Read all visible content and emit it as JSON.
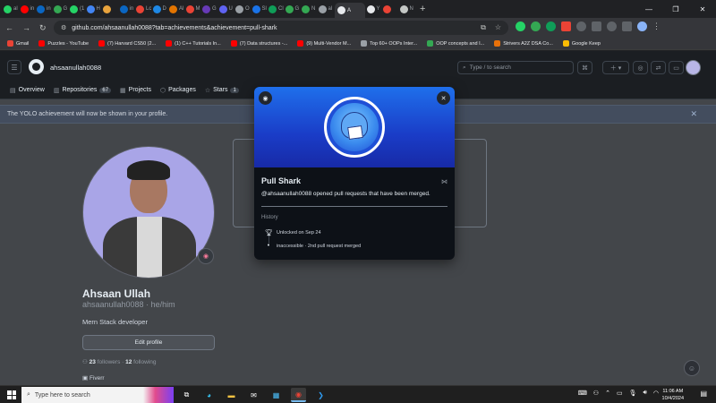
{
  "browser": {
    "tabs": [
      {
        "label": "al",
        "color": "#25d366"
      },
      {
        "label": "in",
        "color": "#ff0000"
      },
      {
        "label": "in (1",
        "color": "#0a66c2"
      },
      {
        "label": "G",
        "color": "#34a853"
      },
      {
        "label": "(1",
        "color": "#25d366"
      },
      {
        "label": "H",
        "color": "#4285f4"
      },
      {
        "label": "",
        "color": "#e8a33d"
      },
      {
        "label": "in (1",
        "color": "#0a66c2"
      },
      {
        "label": "Lc",
        "color": "#ea4335"
      },
      {
        "label": "D",
        "color": "#1e88e5"
      },
      {
        "label": "Al",
        "color": "#e37400"
      },
      {
        "label": "M",
        "color": "#ea4335"
      },
      {
        "label": "G",
        "color": "#673ab7"
      },
      {
        "label": "U",
        "color": "#5f63f2"
      },
      {
        "label": "O",
        "color": "#9aa0a6"
      },
      {
        "label": "Sl",
        "color": "#1a73e8"
      },
      {
        "label": "Cl",
        "color": "#0f9d58"
      },
      {
        "label": "G",
        "color": "#34a853"
      },
      {
        "label": "N",
        "color": "#34a853"
      },
      {
        "label": "al",
        "color": "#9aa0a6"
      },
      {
        "label": "A",
        "color": "#e8eaed",
        "active": true
      },
      {
        "label": "Y",
        "color": "#e8eaed"
      },
      {
        "label": "",
        "color": "#ea4335"
      },
      {
        "label": "N",
        "color": "#c4c7c5"
      }
    ],
    "url": "github.com/ahsaanullah0088?tab=achievements&achievement=pull-shark",
    "bookmarks": [
      {
        "label": "Gmail",
        "color": "#ea4335"
      },
      {
        "label": "Puzzles - YouTube",
        "color": "#ff0000"
      },
      {
        "label": "(7) Harvard CS50 (2...",
        "color": "#ff0000"
      },
      {
        "label": "(1) C++ Tutorials In...",
        "color": "#ff0000"
      },
      {
        "label": "(7) Data structures -...",
        "color": "#ff0000"
      },
      {
        "label": "(9) Multi-Vendor M...",
        "color": "#ff0000"
      },
      {
        "label": "Top 60+ OOPs Inter...",
        "color": "#9aa0a6"
      },
      {
        "label": "OOP concepts and I...",
        "color": "#34a853"
      },
      {
        "label": "Strivers A2Z DSA Co...",
        "color": "#e8710a"
      },
      {
        "label": "Google Keep",
        "color": "#fbbc04"
      }
    ]
  },
  "header": {
    "username": "ahsaanullah0088",
    "search_placeholder": "Type / to search"
  },
  "nav": {
    "items": [
      {
        "label": "Overview",
        "icon": "book-icon"
      },
      {
        "label": "Repositories",
        "count": "67",
        "icon": "repo-icon"
      },
      {
        "label": "Projects",
        "icon": "table-icon"
      },
      {
        "label": "Packages",
        "icon": "package-icon"
      },
      {
        "label": "Stars",
        "count": "1",
        "icon": "star-icon"
      }
    ]
  },
  "banner": {
    "text": "The YOLO achievement will now be shown in your profile."
  },
  "profile": {
    "fullname": "Ahsaan Ullah",
    "login_pronouns": "ahsaanullah0088 · he/him",
    "bio": "Mern Stack developer",
    "edit_label": "Edit profile",
    "followers": "23",
    "followers_label": "followers",
    "following": "12",
    "following_label": "following",
    "link": "Fiverr"
  },
  "modal": {
    "title": "Pull Shark",
    "description": "@ahsaanullah0088 opened pull requests that have been merged.",
    "history_label": "History",
    "history": [
      {
        "text": "Unlocked on Sep 24",
        "icon": "trophy-icon"
      },
      {
        "text": "inaccessible · 2nd pull request merged",
        "icon": "dot-icon"
      }
    ]
  },
  "taskbar": {
    "search_placeholder": "Type here to search",
    "time": "11:06 AM",
    "date": "10/4/2024"
  }
}
